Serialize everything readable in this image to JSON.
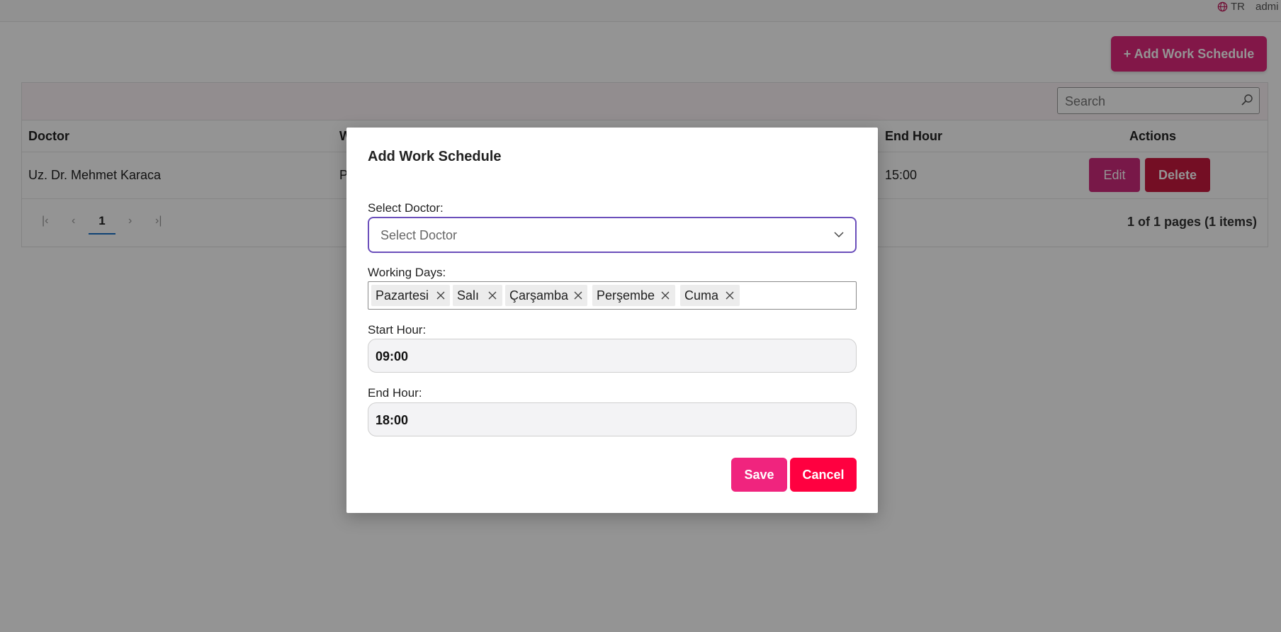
{
  "topbar": {
    "language": "TR",
    "user": "admi"
  },
  "toolbar": {
    "add_button": "+ Add Work Schedule"
  },
  "search": {
    "placeholder": "Search"
  },
  "table": {
    "columns": {
      "doctor": "Doctor",
      "working_days_partial": "W",
      "end_hour": "End Hour",
      "actions": "Actions"
    },
    "rows": [
      {
        "doctor": "Uz. Dr. Mehmet Karaca",
        "working_days_partial": "P",
        "end_hour": "15:00",
        "edit": "Edit",
        "delete": "Delete"
      }
    ]
  },
  "pager": {
    "current_page": "1",
    "info": "1 of 1 pages (1 items)"
  },
  "modal": {
    "title": "Add Work Schedule",
    "select_doctor_label": "Select Doctor:",
    "select_doctor_placeholder": "Select Doctor",
    "working_days_label": "Working Days:",
    "working_days": [
      "Pazartesi",
      "Salı",
      "Çarşamba",
      "Perşembe",
      "Cuma"
    ],
    "start_hour_label": "Start Hour:",
    "start_hour": "09:00",
    "end_hour_label": "End Hour:",
    "end_hour": "18:00",
    "save": "Save",
    "cancel": "Cancel"
  },
  "colors": {
    "primary": "#e0297d",
    "save": "#f0247e",
    "cancel": "#ff0040",
    "delete": "#c8193e",
    "focus_border": "#6b4fbb"
  }
}
